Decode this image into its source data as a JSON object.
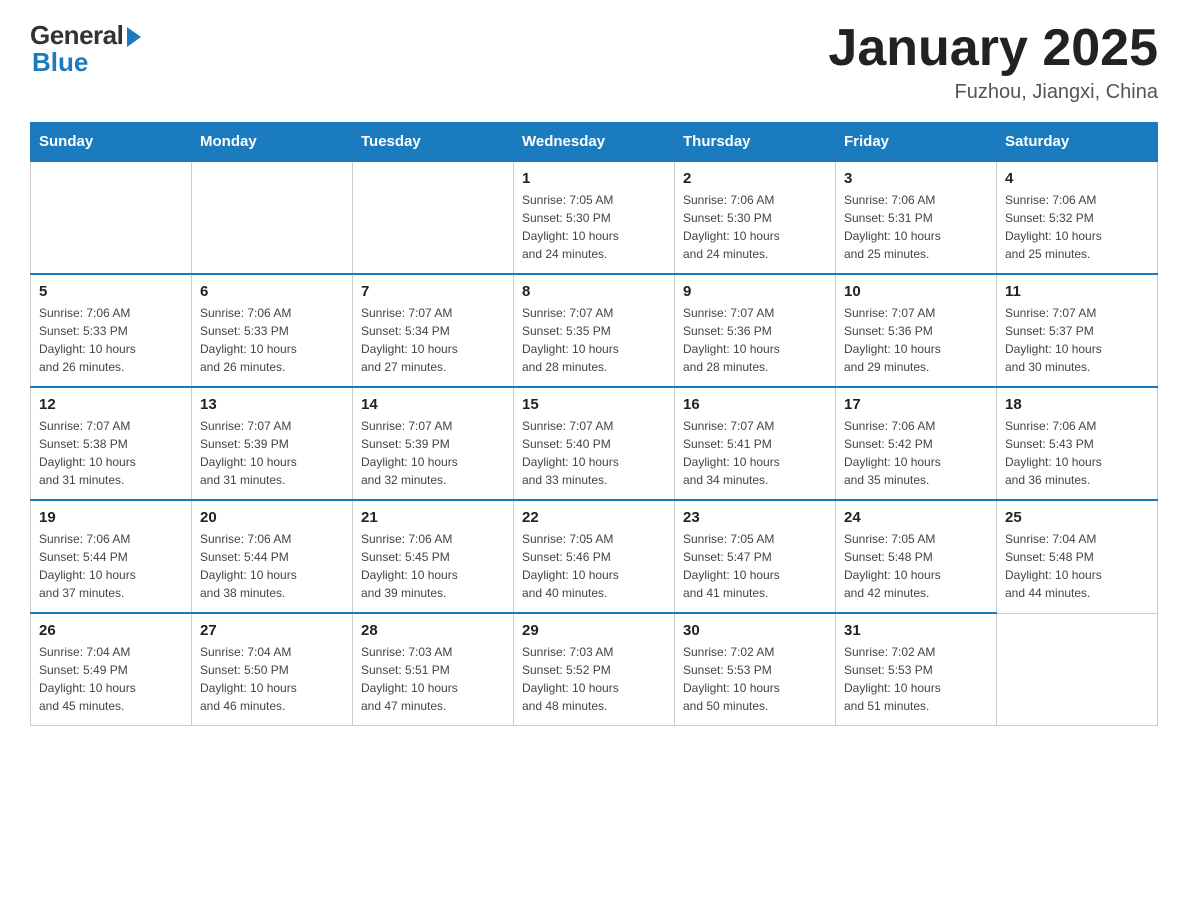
{
  "header": {
    "logo_general": "General",
    "logo_blue": "Blue",
    "month_title": "January 2025",
    "location": "Fuzhou, Jiangxi, China"
  },
  "days_of_week": [
    "Sunday",
    "Monday",
    "Tuesday",
    "Wednesday",
    "Thursday",
    "Friday",
    "Saturday"
  ],
  "weeks": [
    [
      {
        "day": "",
        "info": ""
      },
      {
        "day": "",
        "info": ""
      },
      {
        "day": "",
        "info": ""
      },
      {
        "day": "1",
        "info": "Sunrise: 7:05 AM\nSunset: 5:30 PM\nDaylight: 10 hours\nand 24 minutes."
      },
      {
        "day": "2",
        "info": "Sunrise: 7:06 AM\nSunset: 5:30 PM\nDaylight: 10 hours\nand 24 minutes."
      },
      {
        "day": "3",
        "info": "Sunrise: 7:06 AM\nSunset: 5:31 PM\nDaylight: 10 hours\nand 25 minutes."
      },
      {
        "day": "4",
        "info": "Sunrise: 7:06 AM\nSunset: 5:32 PM\nDaylight: 10 hours\nand 25 minutes."
      }
    ],
    [
      {
        "day": "5",
        "info": "Sunrise: 7:06 AM\nSunset: 5:33 PM\nDaylight: 10 hours\nand 26 minutes."
      },
      {
        "day": "6",
        "info": "Sunrise: 7:06 AM\nSunset: 5:33 PM\nDaylight: 10 hours\nand 26 minutes."
      },
      {
        "day": "7",
        "info": "Sunrise: 7:07 AM\nSunset: 5:34 PM\nDaylight: 10 hours\nand 27 minutes."
      },
      {
        "day": "8",
        "info": "Sunrise: 7:07 AM\nSunset: 5:35 PM\nDaylight: 10 hours\nand 28 minutes."
      },
      {
        "day": "9",
        "info": "Sunrise: 7:07 AM\nSunset: 5:36 PM\nDaylight: 10 hours\nand 28 minutes."
      },
      {
        "day": "10",
        "info": "Sunrise: 7:07 AM\nSunset: 5:36 PM\nDaylight: 10 hours\nand 29 minutes."
      },
      {
        "day": "11",
        "info": "Sunrise: 7:07 AM\nSunset: 5:37 PM\nDaylight: 10 hours\nand 30 minutes."
      }
    ],
    [
      {
        "day": "12",
        "info": "Sunrise: 7:07 AM\nSunset: 5:38 PM\nDaylight: 10 hours\nand 31 minutes."
      },
      {
        "day": "13",
        "info": "Sunrise: 7:07 AM\nSunset: 5:39 PM\nDaylight: 10 hours\nand 31 minutes."
      },
      {
        "day": "14",
        "info": "Sunrise: 7:07 AM\nSunset: 5:39 PM\nDaylight: 10 hours\nand 32 minutes."
      },
      {
        "day": "15",
        "info": "Sunrise: 7:07 AM\nSunset: 5:40 PM\nDaylight: 10 hours\nand 33 minutes."
      },
      {
        "day": "16",
        "info": "Sunrise: 7:07 AM\nSunset: 5:41 PM\nDaylight: 10 hours\nand 34 minutes."
      },
      {
        "day": "17",
        "info": "Sunrise: 7:06 AM\nSunset: 5:42 PM\nDaylight: 10 hours\nand 35 minutes."
      },
      {
        "day": "18",
        "info": "Sunrise: 7:06 AM\nSunset: 5:43 PM\nDaylight: 10 hours\nand 36 minutes."
      }
    ],
    [
      {
        "day": "19",
        "info": "Sunrise: 7:06 AM\nSunset: 5:44 PM\nDaylight: 10 hours\nand 37 minutes."
      },
      {
        "day": "20",
        "info": "Sunrise: 7:06 AM\nSunset: 5:44 PM\nDaylight: 10 hours\nand 38 minutes."
      },
      {
        "day": "21",
        "info": "Sunrise: 7:06 AM\nSunset: 5:45 PM\nDaylight: 10 hours\nand 39 minutes."
      },
      {
        "day": "22",
        "info": "Sunrise: 7:05 AM\nSunset: 5:46 PM\nDaylight: 10 hours\nand 40 minutes."
      },
      {
        "day": "23",
        "info": "Sunrise: 7:05 AM\nSunset: 5:47 PM\nDaylight: 10 hours\nand 41 minutes."
      },
      {
        "day": "24",
        "info": "Sunrise: 7:05 AM\nSunset: 5:48 PM\nDaylight: 10 hours\nand 42 minutes."
      },
      {
        "day": "25",
        "info": "Sunrise: 7:04 AM\nSunset: 5:48 PM\nDaylight: 10 hours\nand 44 minutes."
      }
    ],
    [
      {
        "day": "26",
        "info": "Sunrise: 7:04 AM\nSunset: 5:49 PM\nDaylight: 10 hours\nand 45 minutes."
      },
      {
        "day": "27",
        "info": "Sunrise: 7:04 AM\nSunset: 5:50 PM\nDaylight: 10 hours\nand 46 minutes."
      },
      {
        "day": "28",
        "info": "Sunrise: 7:03 AM\nSunset: 5:51 PM\nDaylight: 10 hours\nand 47 minutes."
      },
      {
        "day": "29",
        "info": "Sunrise: 7:03 AM\nSunset: 5:52 PM\nDaylight: 10 hours\nand 48 minutes."
      },
      {
        "day": "30",
        "info": "Sunrise: 7:02 AM\nSunset: 5:53 PM\nDaylight: 10 hours\nand 50 minutes."
      },
      {
        "day": "31",
        "info": "Sunrise: 7:02 AM\nSunset: 5:53 PM\nDaylight: 10 hours\nand 51 minutes."
      },
      {
        "day": "",
        "info": ""
      }
    ]
  ]
}
